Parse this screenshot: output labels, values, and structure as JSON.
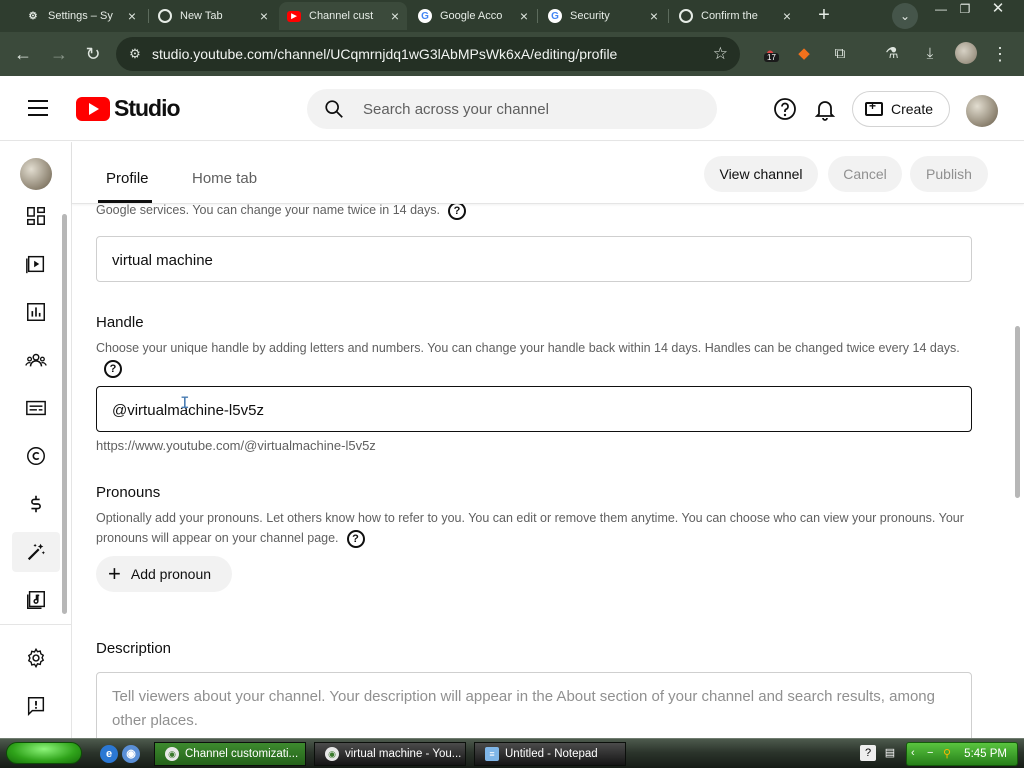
{
  "browser": {
    "tabs": [
      {
        "label": "Settings – Sy",
        "icon": "gear-icon"
      },
      {
        "label": "New Tab",
        "icon": "chrome-icon"
      },
      {
        "label": "Channel cust",
        "icon": "youtube-icon"
      },
      {
        "label": "Google Acco",
        "icon": "google-icon"
      },
      {
        "label": "Security",
        "icon": "google-icon"
      },
      {
        "label": "Confirm the",
        "icon": "chrome-icon"
      }
    ],
    "url": "studio.youtube.com/channel/UCqmrnjdq1wG3lAbMPsWk6xA/editing/profile",
    "extension_badge": "17"
  },
  "header": {
    "logo_text": "Studio",
    "search_placeholder": "Search across your channel",
    "create_label": "Create"
  },
  "page_tabs": {
    "profile": "Profile",
    "home": "Home tab",
    "view_channel": "View channel",
    "cancel": "Cancel",
    "publish": "Publish"
  },
  "name_section": {
    "hint_tail": "Google services. You can change your name twice in 14 days.",
    "value": "virtual machine"
  },
  "handle_section": {
    "title": "Handle",
    "hint": "Choose your unique handle by adding letters and numbers. You can change your handle back within 14 days. Handles can be changed twice every 14 days.",
    "value": "@virtualmachine-l5v5z",
    "url": "https://www.youtube.com/@virtualmachine-l5v5z"
  },
  "pronouns_section": {
    "title": "Pronouns",
    "hint": "Optionally add your pronouns. Let others know how to refer to you. You can edit or remove them anytime. You can choose who can view your pronouns. Your pronouns will appear on your channel page.",
    "add_label": "Add pronoun"
  },
  "description_section": {
    "title": "Description",
    "placeholder": "Tell viewers about your channel. Your description will appear in the About section of your channel and search results, among other places."
  },
  "help_glyph": "?",
  "taskbar": {
    "tasks": [
      {
        "label": "Channel customizati...",
        "state": "active"
      },
      {
        "label": "virtual machine - You...",
        "state": "normal"
      },
      {
        "label": "Untitled - Notepad",
        "state": "normal"
      }
    ],
    "clock": "5:45 PM"
  },
  "colors": {
    "youtube_red": "#ff0000",
    "chrome_frame": "#2f3d2f",
    "taskbar_green": "#3d8a2e"
  }
}
